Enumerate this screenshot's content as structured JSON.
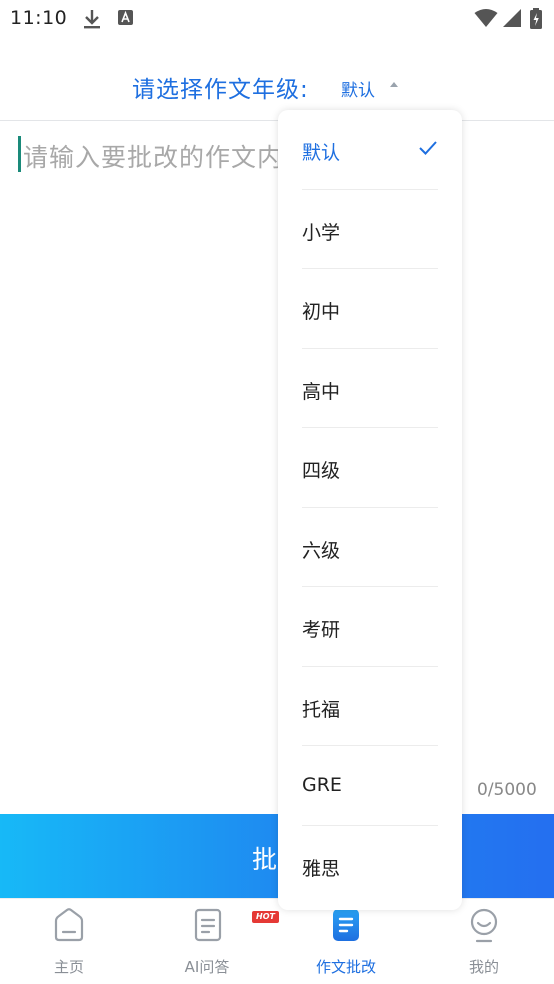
{
  "status_bar": {
    "time": "11:10",
    "icons": [
      "download-icon",
      "a-notification-icon",
      "wifi-icon",
      "signal-icon",
      "battery-icon"
    ]
  },
  "header": {
    "grade_label": "请选择作文年级:",
    "grade_value": "默认"
  },
  "editor": {
    "placeholder": "请输入要批改的作文内",
    "counter": "0/5000"
  },
  "submit": {
    "label": "批"
  },
  "dropdown": {
    "selected": "默认",
    "items": [
      "默认",
      "小学",
      "初中",
      "高中",
      "四级",
      "六级",
      "考研",
      "托福",
      "GRE",
      "雅思"
    ]
  },
  "tabs": [
    {
      "label": "主页",
      "icon": "home-icon"
    },
    {
      "label": "AI问答",
      "icon": "document-icon",
      "badge": "HOT"
    },
    {
      "label": "作文批改",
      "icon": "essay-icon",
      "active": true
    },
    {
      "label": "我的",
      "icon": "profile-icon"
    }
  ],
  "colors": {
    "accent": "#1e6fe0",
    "button_gradient_start": "#17b9f7",
    "button_gradient_end": "#246ff0",
    "hot_badge": "#e53935"
  }
}
